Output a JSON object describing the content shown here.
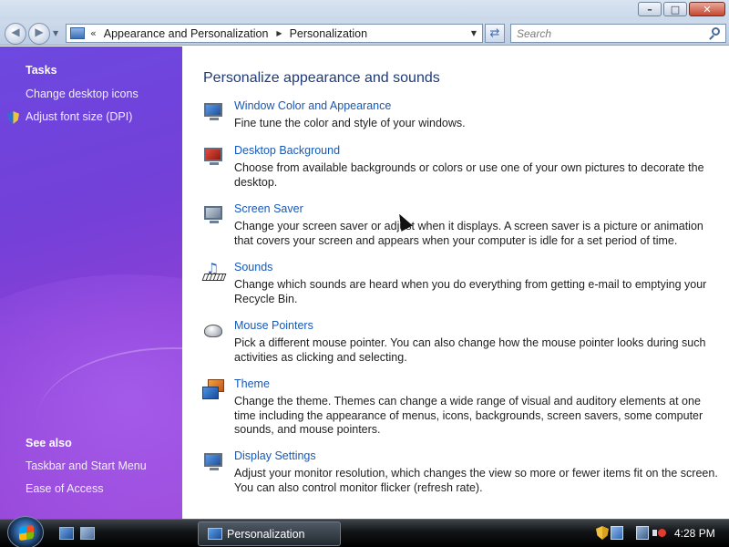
{
  "window": {
    "buttons": {
      "minimize_glyph": "–",
      "maximize_glyph": "□",
      "close_glyph": "✕"
    }
  },
  "nav": {
    "back_glyph": "◀",
    "forward_glyph": "▶",
    "dropdown_glyph": "▼",
    "address": {
      "overflow_glyph": "«",
      "breadcrumbs": [
        "Appearance and Personalization",
        "Personalization"
      ],
      "separator_glyph": "▶",
      "dropdown_glyph": "▼"
    },
    "refresh_glyph": "⇄",
    "search": {
      "placeholder": "Search"
    }
  },
  "sidebar": {
    "tasks_heading": "Tasks",
    "tasks": [
      {
        "label": "Change desktop icons"
      },
      {
        "label": "Adjust font size (DPI)",
        "icon": "uac-shield-icon"
      }
    ],
    "see_also_heading": "See also",
    "see_also": [
      {
        "label": "Taskbar and Start Menu"
      },
      {
        "label": "Ease of Access"
      }
    ]
  },
  "main": {
    "title": "Personalize appearance and sounds",
    "items": [
      {
        "title": "Window Color and Appearance",
        "description": "Fine tune the color and style of your windows.",
        "icon": "window-color-icon"
      },
      {
        "title": "Desktop Background",
        "description": "Choose from available backgrounds or colors or use one of your own pictures to decorate the desktop.",
        "icon": "desktop-background-icon"
      },
      {
        "title": "Screen Saver",
        "description": "Change your screen saver or adjust when it displays. A screen saver is a picture or animation that covers your screen and appears when your computer is idle for a set period of time.",
        "icon": "screen-saver-icon"
      },
      {
        "title": "Sounds",
        "description": "Change which sounds are heard when you do everything from getting e-mail to emptying your Recycle Bin.",
        "icon": "sounds-icon"
      },
      {
        "title": "Mouse Pointers",
        "description": "Pick a different mouse pointer. You can also change how the mouse pointer looks during such activities as clicking and selecting.",
        "icon": "mouse-pointers-icon"
      },
      {
        "title": "Theme",
        "description": "Change the theme. Themes can change a wide range of visual and auditory elements at one time including the appearance of menus, icons, backgrounds, screen savers, some computer sounds, and mouse pointers.",
        "icon": "theme-icon"
      },
      {
        "title": "Display Settings",
        "description": "Adjust your monitor resolution, which changes the view so more or fewer items fit on the screen. You can also control monitor flicker (refresh rate).",
        "icon": "display-settings-icon"
      }
    ]
  },
  "taskbar": {
    "active_window": "Personalization",
    "clock": "4:28 PM"
  },
  "colors": {
    "sidebar_accent": "#7340d8",
    "link": "#1659b8",
    "title": "#1f3b7a"
  }
}
